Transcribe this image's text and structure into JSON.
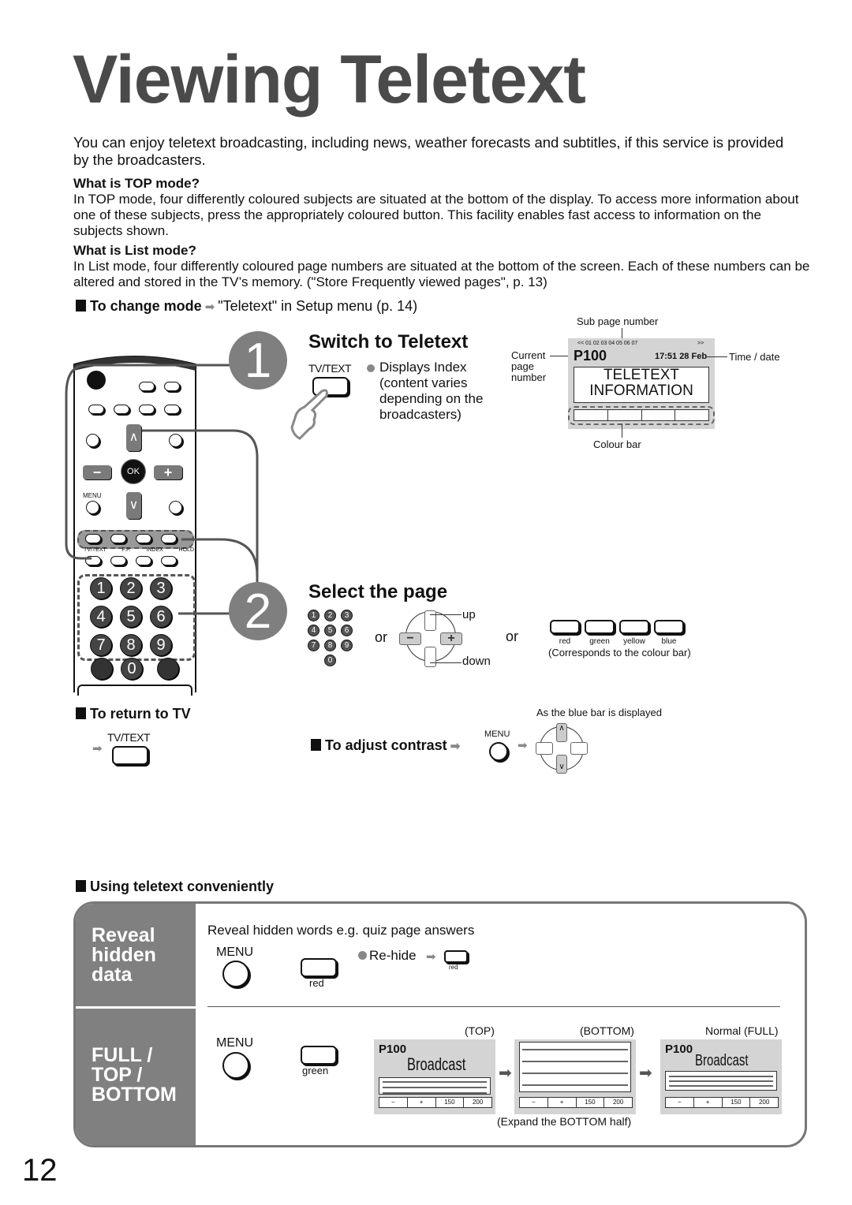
{
  "page": {
    "title": "Viewing Teletext",
    "page_number": "12",
    "intro": "You can enjoy teletext broadcasting, including news, weather forecasts and subtitles, if this service is provided by the broadcasters."
  },
  "top_mode": {
    "heading": "What is TOP mode?",
    "text": "In TOP mode, four differently coloured subjects are situated at the bottom of the display. To access more information about one of these subjects, press the appropriately coloured button. This facility enables fast access to information on the subjects shown."
  },
  "list_mode": {
    "heading": "What is List mode?",
    "text": "In List mode, four differently coloured page numbers are situated at the bottom of the screen. Each of these numbers can be altered and stored in the TV’s memory. (\"Store Frequently viewed pages\", p. 13)"
  },
  "change_mode": {
    "label": "To change mode",
    "text": "\"Teletext\" in Setup menu (p. 14)"
  },
  "remote": {
    "ok_label": "OK",
    "menu_label": "MENU",
    "minus": "−",
    "plus": "+",
    "up": "∧",
    "down": "∨",
    "func_labels": [
      "TV/TEXT",
      "F.P.",
      "INDEX",
      "HOLD"
    ],
    "numbers": [
      "1",
      "2",
      "3",
      "4",
      "5",
      "6",
      "7",
      "8",
      "9",
      "0"
    ]
  },
  "step1": {
    "number": "1",
    "title": "Switch to Teletext",
    "button_label": "TV/TEXT",
    "desc": "Displays Index (content varies depending on the broadcasters)"
  },
  "tt_diagram": {
    "sub_page_label": "Sub page number",
    "sub_pages": "<< 01 02 03 04 05 06 07",
    "sub_next": ">>",
    "current_label": "Current page number",
    "page": "P100",
    "time": "17:51 28 Feb",
    "time_label": "Time / date",
    "content_line1": "TELETEXT",
    "content_line2": "INFORMATION",
    "colour_bar_label": "Colour bar"
  },
  "step2": {
    "number": "2",
    "title": "Select the page",
    "or1": "or",
    "or2": "or",
    "up_label": "up",
    "down_label": "down",
    "minus": "−",
    "plus": "+",
    "numbers": [
      "1",
      "2",
      "3",
      "4",
      "5",
      "6",
      "7",
      "8",
      "9",
      "0"
    ],
    "colour_buttons": [
      "red",
      "green",
      "yellow",
      "blue"
    ],
    "colour_note": "(Corresponds to the colour bar)"
  },
  "return_tv": {
    "label": "To return to TV",
    "button_label": "TV/TEXT"
  },
  "contrast": {
    "label": "To adjust contrast",
    "menu_label": "MENU",
    "note": "As the blue bar is displayed"
  },
  "convenient": {
    "heading": "Using teletext conveniently",
    "reveal": {
      "side": [
        "Reveal",
        "hidden",
        "data"
      ],
      "desc": "Reveal hidden words e.g. quiz page answers",
      "menu_label": "MENU",
      "button_label": "red",
      "rehide_label": "Re-hide",
      "rehide_button": "red"
    },
    "full": {
      "side": [
        "FULL /",
        "TOP /",
        "BOTTOM"
      ],
      "menu_label": "MENU",
      "button_label": "green",
      "screens": [
        {
          "caption": "(TOP)",
          "page": "P100",
          "title": "Broadcast"
        },
        {
          "caption": "(BOTTOM)",
          "page": "",
          "title": ""
        },
        {
          "caption": "Normal (FULL)",
          "page": "P100",
          "title": "Broadcast"
        }
      ],
      "bar_cells": [
        "−",
        "+",
        "150",
        "200"
      ],
      "expand_note": "(Expand the BOTTOM half)"
    }
  }
}
